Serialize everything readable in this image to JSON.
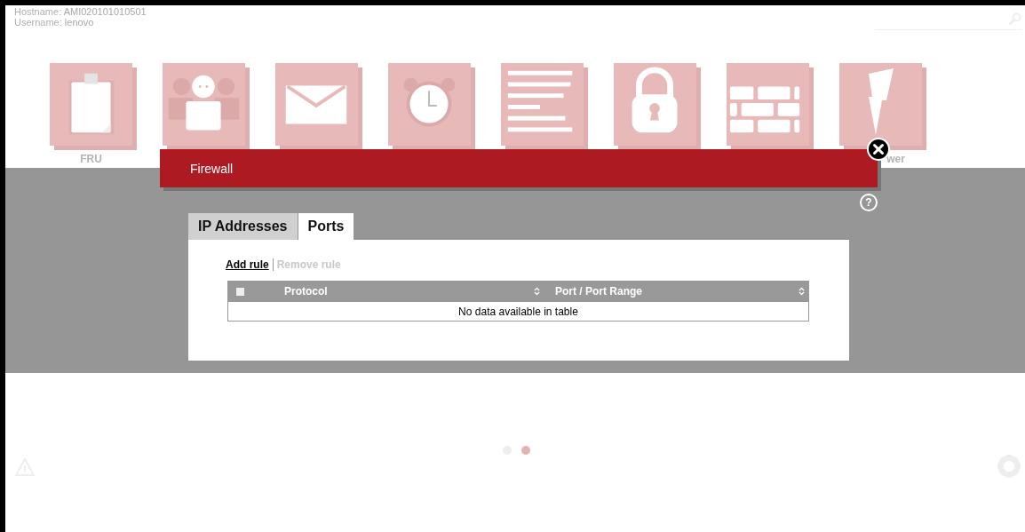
{
  "header": {
    "hostname_label": "Hostname:",
    "hostname": "AMI020101010501",
    "username_label": "Username:",
    "username": "lenovo"
  },
  "tiles": [
    {
      "kind": "clipboard",
      "label": "FRU"
    },
    {
      "kind": "people"
    },
    {
      "kind": "envelope"
    },
    {
      "kind": "clock"
    },
    {
      "kind": "list"
    },
    {
      "kind": "lock"
    },
    {
      "kind": "wall"
    },
    {
      "kind": "lightning",
      "label": "wer"
    }
  ],
  "dialog": {
    "title": "Firewall",
    "help": "?",
    "tabs": [
      {
        "label": "IP Addresses",
        "selected": false
      },
      {
        "label": "Ports",
        "selected": true
      }
    ],
    "actions": [
      {
        "label": "Add rule",
        "disabled": false
      },
      {
        "label": "Remove rule",
        "disabled": true
      }
    ],
    "table": {
      "select_all_checked": false,
      "columns": [
        {
          "label": "Protocol"
        },
        {
          "label": "Port / Port Range"
        }
      ],
      "empty_message": "No data available in table"
    }
  },
  "pager": [
    {
      "selected": false
    },
    {
      "selected": true
    }
  ]
}
